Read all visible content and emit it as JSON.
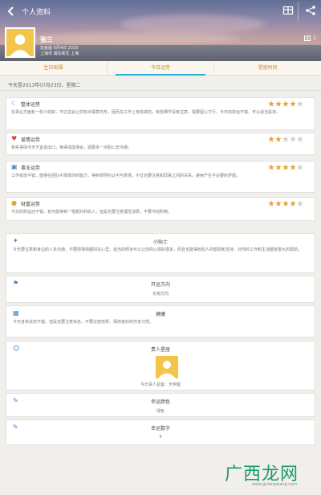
{
  "app": {
    "title": "个人资料",
    "back_icon": "back-arrow-icon",
    "icons": [
      "grid-icon",
      "share-icon"
    ]
  },
  "profile": {
    "name": "张三",
    "line1": "双鱼座 6月4日 2016",
    "line2": "上海市 浦东新区 上海",
    "photo_count": "1"
  },
  "tabs": [
    {
      "label": "生日祝福",
      "active": false
    },
    {
      "label": "今日运势",
      "active": true
    },
    {
      "label": "星座时间",
      "active": false
    }
  ],
  "date_line": "今天是2013年07月23日，星期二",
  "fortune_cards": [
    {
      "label": "整体运势",
      "icon": "moon-icon",
      "icon_color": "#3a87c8",
      "rating": 4,
      "text": "在事业方面有一些小收获，不过这会让你有点得意忘形，因而在工作上有些疏忽，有些细节没有注意，需要留心才行。今天的财运不错，可以适当投资。"
    },
    {
      "label": "爱情运势",
      "icon": "heart-icon",
      "icon_color": "#d8463e",
      "rating": 2,
      "text": "有些事情今天不宜说出口，免得造成误会，需要多一点耐心去沟通。"
    },
    {
      "label": "事业运势",
      "icon": "briefcase-icon",
      "icon_color": "#3a87c8",
      "rating": 4,
      "text": "工作状态不错，能够在团队中发挥你的能力，得到领导的认可与表扬，不过也要注意和同事之间的关系，避免产生不必要的矛盾。"
    },
    {
      "label": "财富运势",
      "icon": "coin-icon",
      "icon_color": "#e2a23a",
      "rating": 4,
      "text": "今天的财运还不错，有可能得到一笔额外的收入，但是也要注意理性消费，不要冲动购物。"
    }
  ],
  "sections": {
    "lucky_star": {
      "title": "小贴士",
      "icon": "star-ribbon-icon",
      "text": "今天要注意和身边的人多沟通，不要把事情都闷在心里，适当的倾诉可以让你的心情好很多，而且也能得到别人的帮助和支持，对你的工作和生活都有很大的帮助。"
    },
    "lucky_direction": {
      "title": "开运方向",
      "icon": "flag-icon",
      "value": "东南方向"
    },
    "health": {
      "title": "健康",
      "icon": "calendar-icon",
      "text": "今天身体状态不错，但是也要注意休息，不要过度劳累，保持良好的作息习惯。"
    },
    "friend": {
      "title": "贵人星座",
      "icon": "person-icon",
      "caption": "今日贵人星座：天秤座"
    },
    "lucky_color": {
      "title": "幸运颜色",
      "icon": "pen-icon",
      "value": "绿色"
    },
    "lucky_number": {
      "title": "幸运数字",
      "icon": "pen-icon",
      "value": "4"
    }
  },
  "watermark": {
    "text": "广西龙网",
    "url": "www.gxlongwang.com"
  },
  "colors": {
    "accent": "#2ab0d4",
    "tab_text": "#c88b2b",
    "star_on": "#e8a63a",
    "star_off": "#cfcfcf"
  }
}
